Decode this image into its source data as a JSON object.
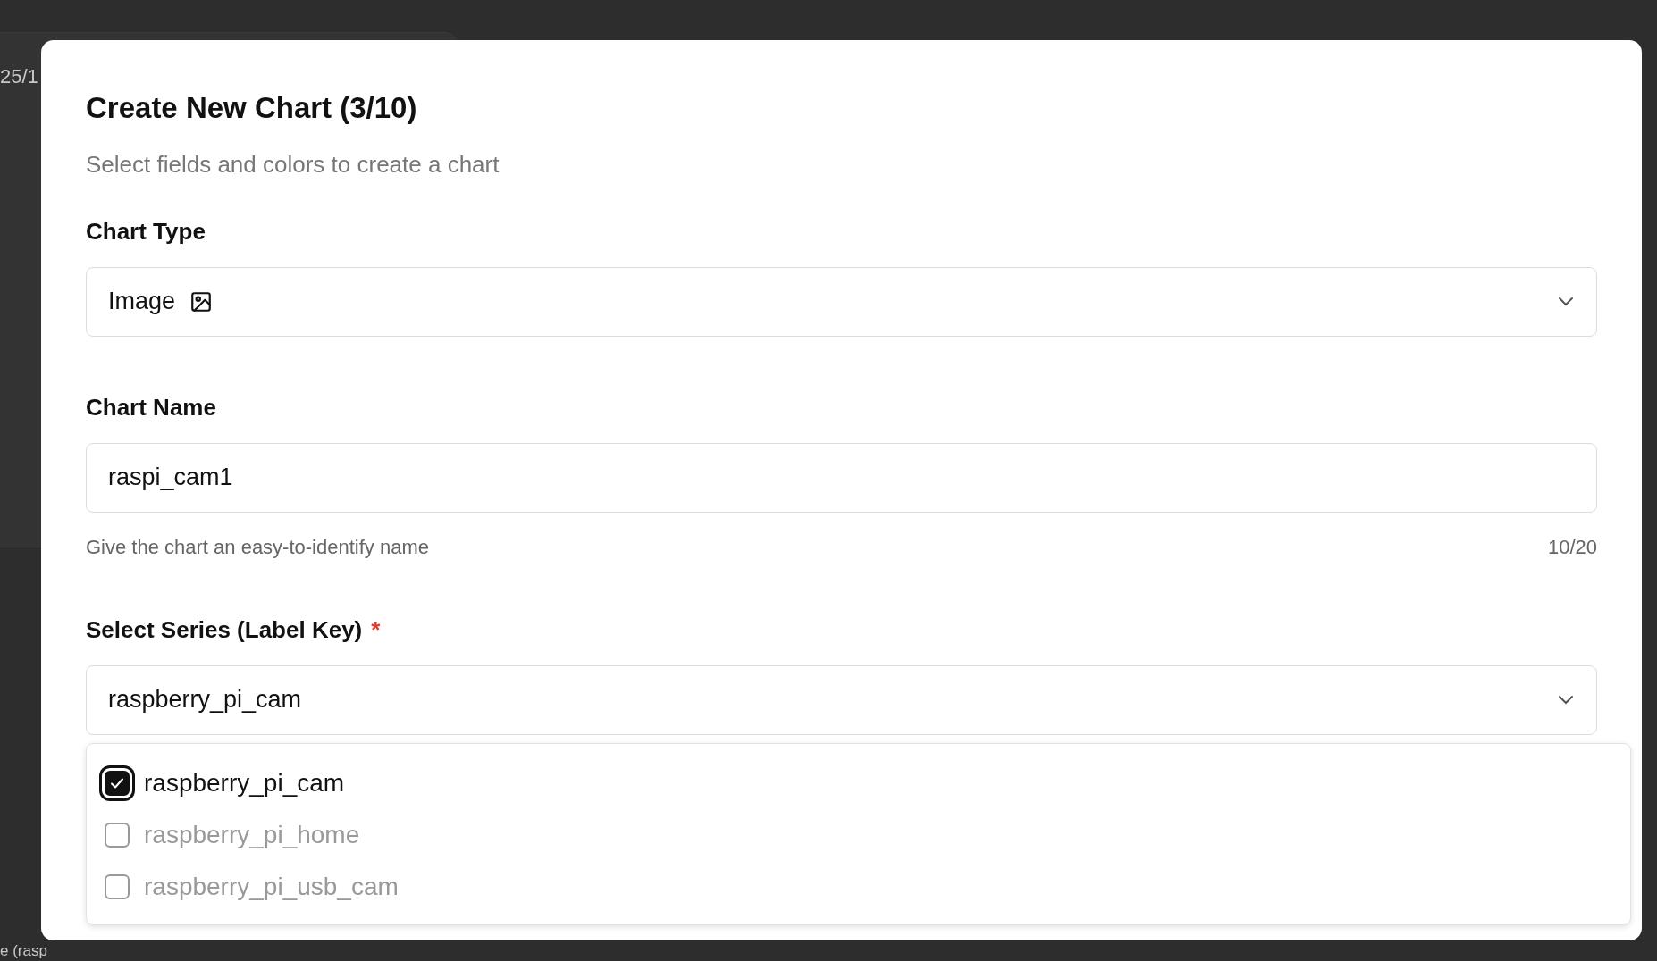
{
  "background": {
    "texts": [
      "25/1",
      "e (rasp"
    ]
  },
  "dialog": {
    "title": "Create New Chart (3/10)",
    "subtitle": "Select fields and colors to create a chart",
    "chart_type": {
      "label": "Chart Type",
      "value": "Image"
    },
    "chart_name": {
      "label": "Chart Name",
      "value": "raspi_cam1",
      "hint": "Give the chart an easy-to-identify name",
      "counter": "10/20"
    },
    "series": {
      "label": "Select Series (Label Key)",
      "required_mark": "*",
      "value": "raspberry_pi_cam",
      "expanded": true,
      "options": [
        {
          "label": "raspberry_pi_cam",
          "checked": true
        },
        {
          "label": "raspberry_pi_home",
          "checked": false
        },
        {
          "label": "raspberry_pi_usb_cam",
          "checked": false
        }
      ]
    }
  }
}
